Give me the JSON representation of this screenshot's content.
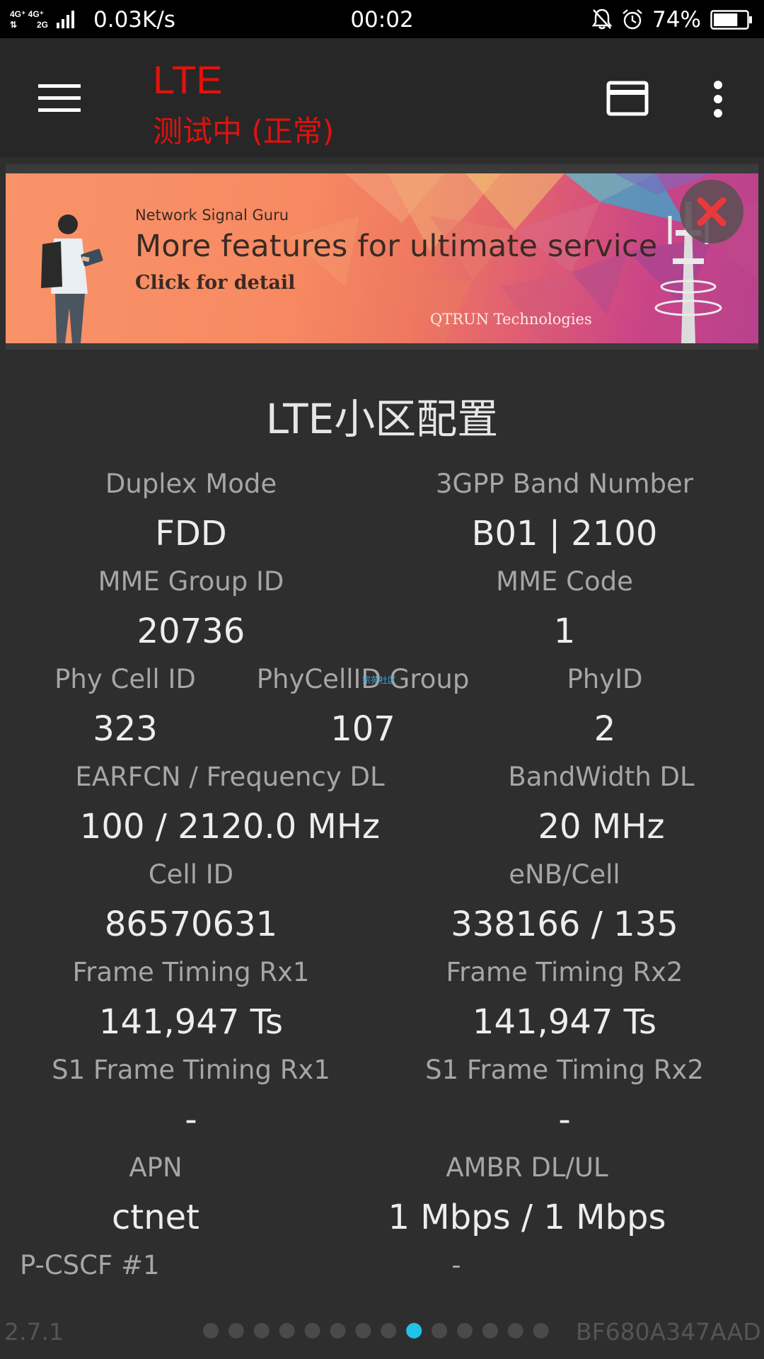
{
  "status_bar": {
    "network_label_top": "4G⁺ 4G⁺",
    "network_label_bottom": "2G",
    "speed": "0.03K/s",
    "time": "00:02",
    "battery_pct": "74%",
    "battery_level": 0.74,
    "icons": [
      "signal-icon",
      "mute-bell-icon",
      "alarm-icon",
      "battery-icon"
    ]
  },
  "app_bar": {
    "title": "LTE",
    "subtitle": "测试中 (正常)",
    "title_color": "#e0120e",
    "icons": [
      "menu-icon",
      "card-view-icon",
      "more-vert-icon"
    ]
  },
  "banner": {
    "brand": "Network Signal Guru",
    "headline": "More features for ultimate service",
    "cta": "Click for detail",
    "company": "QTRUN Technologies"
  },
  "section": {
    "title": "LTE小区配置",
    "fields": [
      {
        "label": "Duplex Mode",
        "value": "FDD"
      },
      {
        "label": "3GPP Band Number",
        "value": "B01 | 2100"
      },
      {
        "label": "MME Group ID",
        "value": "20736"
      },
      {
        "label": "MME Code",
        "value": "1"
      },
      {
        "label": "Phy Cell ID",
        "value": "323"
      },
      {
        "label": "PhyCellID Group",
        "value": "107"
      },
      {
        "label": "PhyID",
        "value": "2"
      },
      {
        "label": "EARFCN / Frequency DL",
        "value": "100 / 2120.0 MHz"
      },
      {
        "label": "BandWidth DL",
        "value": "20 MHz"
      },
      {
        "label": "Cell ID",
        "value": "86570631"
      },
      {
        "label": "eNB/Cell",
        "value": "338166 / 135"
      },
      {
        "label": "Frame Timing Rx1",
        "value": "141,947 Ts"
      },
      {
        "label": "Frame Timing Rx2",
        "value": "141,947 Ts"
      },
      {
        "label": "S1 Frame Timing Rx1",
        "value": "-"
      },
      {
        "label": "S1 Frame Timing Rx2",
        "value": "-"
      },
      {
        "label": "APN",
        "value": "ctnet"
      },
      {
        "label": "AMBR DL/UL",
        "value": "1 Mbps / 1 Mbps"
      },
      {
        "label": "P-CSCF #1",
        "value": "-"
      }
    ]
  },
  "watermark": "宗苑社区",
  "footer": {
    "version": "2.7.1",
    "device_id": "BF680A347AAD",
    "page_count": 14,
    "active_page": 9,
    "active_color": "#22c2e8",
    "inactive_color": "#4a4a4a"
  }
}
